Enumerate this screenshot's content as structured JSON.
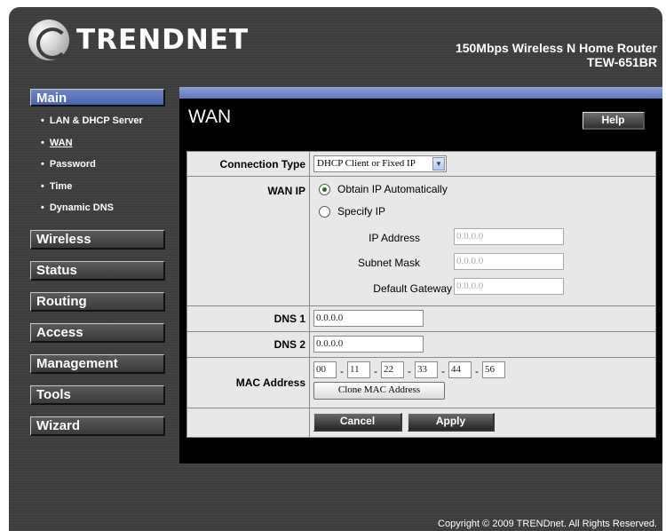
{
  "header": {
    "logo_text": "TRENDNET",
    "product_name": "150Mbps Wireless N Home Router",
    "product_model": "TEW-651BR"
  },
  "sidebar": {
    "main_label": "Main",
    "sub_items": [
      {
        "label": "LAN & DHCP Server",
        "active": false
      },
      {
        "label": "WAN",
        "active": true
      },
      {
        "label": "Password",
        "active": false
      },
      {
        "label": "Time",
        "active": false
      },
      {
        "label": "Dynamic DNS",
        "active": false
      }
    ],
    "menu_items": [
      "Wireless",
      "Status",
      "Routing",
      "Access",
      "Management",
      "Tools",
      "Wizard"
    ]
  },
  "panel": {
    "title": "WAN",
    "help_label": "Help"
  },
  "form": {
    "connection_type_label": "Connection Type",
    "connection_type_value": "DHCP Client or Fixed IP",
    "wan_ip_label": "WAN IP",
    "obtain_label": "Obtain IP Automatically",
    "specify_label": "Specify IP",
    "ip_address_label": "IP Address",
    "ip_address_value": "0.0.0.0",
    "subnet_mask_label": "Subnet Mask",
    "subnet_mask_value": "0.0.0.0",
    "gateway_label": "Default Gateway",
    "gateway_value": "0.0.0.0",
    "dns1_label": "DNS 1",
    "dns1_value": "0.0.0.0",
    "dns2_label": "DNS 2",
    "dns2_value": "0.0.0.0",
    "mac_label": "MAC Address",
    "mac_octets": [
      "00",
      "11",
      "22",
      "33",
      "44",
      "56"
    ],
    "mac_separator": "-",
    "clone_label": "Clone MAC Address",
    "cancel_label": "Cancel",
    "apply_label": "Apply"
  },
  "footer": {
    "copyright": "Copyright © 2009 TRENDnet. All Rights Reserved."
  }
}
